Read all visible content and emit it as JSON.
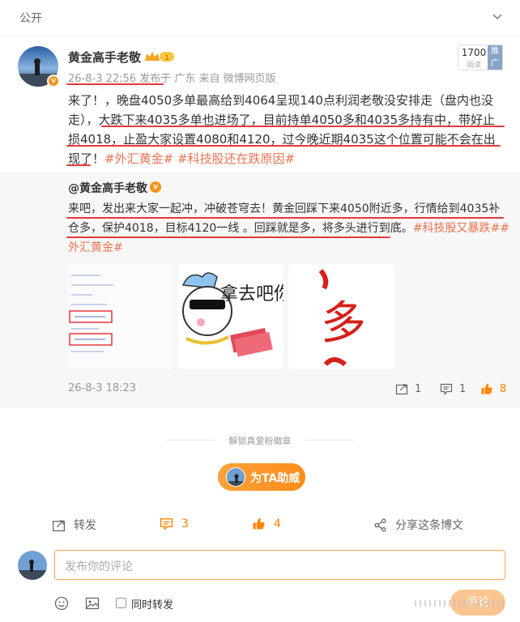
{
  "header": {
    "visibility_label": "公开"
  },
  "post": {
    "author": "黄金高手老敬",
    "vip_level": "1",
    "meta_time": "26-8-3 22:56",
    "meta_suffix": "发布于 广东 来自 微博网页版",
    "rank_number": "1700",
    "rank_sub": "阅读",
    "rank_tag": "推广",
    "text_parts": [
      "来了！，晚盘4050多单最高给到4064呈现140点利润老敬没安排走（盘内也没走），大跌下来4035多单也进场了，目前持单4050多和4035多持有中，带好止损4018，止盈大家设置4080和4120，过今晚近期4035这个位置可能不会在出现了！"
    ],
    "tags": [
      "#外汇黄金#",
      "#科技股还在跌原因#"
    ]
  },
  "repost": {
    "author": "@黄金高手老敬",
    "text": "来吧，发出来大家一起冲，冲破苍穹去！黄金回踩下来4050附近多，行情给到4035补仓多，保护4018，目标4120一线 。回踩就是多，将多头进行到底。",
    "tags": [
      "#科技股又暴跌#",
      "#外汇黄金#"
    ],
    "images": [
      {
        "kind": "screenshot"
      },
      {
        "kind": "sticker",
        "text": "拿去吧你"
      },
      {
        "kind": "calligraphy",
        "text": "多"
      }
    ],
    "time": "26-8-3 18:23",
    "repost_count": "1",
    "comment_count": "1",
    "like_count": "8"
  },
  "divider": {
    "text": "解锁真爱粉徽章"
  },
  "boost": {
    "label": "为TA助威"
  },
  "actions": {
    "repost_label": "转发",
    "comment_count": "3",
    "like_count": "4",
    "share_label": "分享这条博文"
  },
  "comment": {
    "placeholder": "发布你的评论",
    "also_repost_label": "同时转发",
    "send_label": "评论"
  },
  "colors": {
    "accent": "#ff8200",
    "tag": "#eb7350",
    "underline": "#e4393c",
    "like": "#ff8200"
  }
}
